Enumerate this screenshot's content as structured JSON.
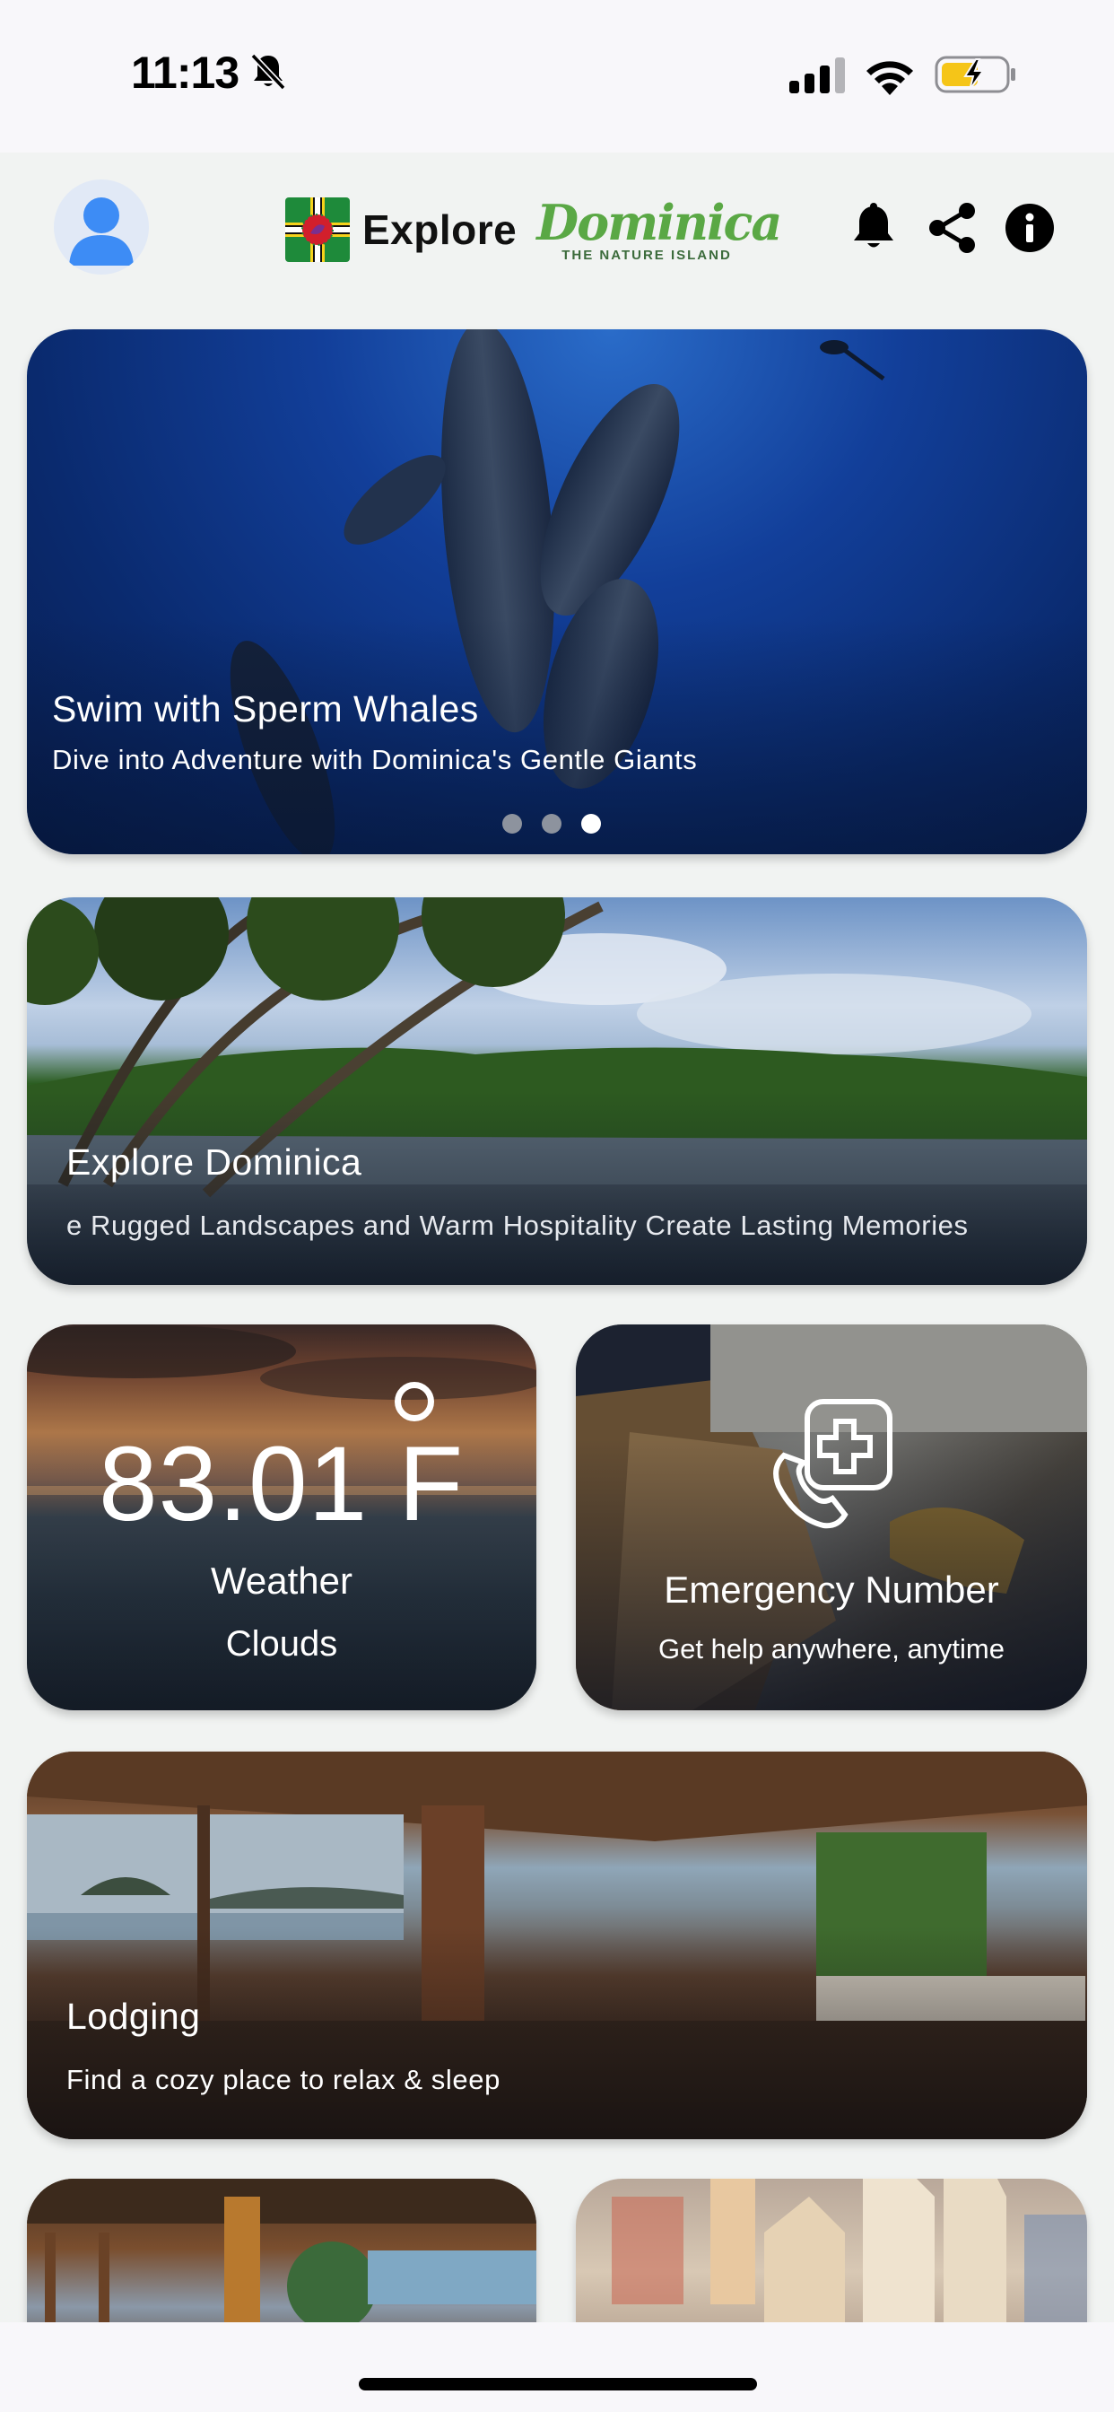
{
  "status_bar": {
    "time": "11:13",
    "icons": [
      "bell-muted-icon",
      "cellular-signal-icon",
      "wifi-icon",
      "battery-charging-icon"
    ],
    "battery_color": "#f5c518"
  },
  "header": {
    "avatar_icon": "user-avatar-icon",
    "logo_word": "Explore",
    "brand_name": "Dominica",
    "brand_tagline": "THE NATURE ISLAND",
    "brand_color": "#5aa845",
    "actions": [
      "bell-icon",
      "share-icon",
      "info-icon"
    ]
  },
  "hero": {
    "title": "Swim with Sperm Whales",
    "subtitle": "Dive into Adventure with Dominica's Gentle Giants",
    "slides": 3,
    "active_slide": 3
  },
  "explore": {
    "title": "Explore Dominica",
    "subtitle": "e Rugged Landscapes and Warm Hospitality Create Lasting Memories"
  },
  "weather": {
    "temperature": "83.01 F",
    "label": "Weather",
    "condition": "Clouds"
  },
  "emergency": {
    "title": "Emergency Number",
    "subtitle": "Get help anywhere, anytime",
    "icon": "emergency-phone-medical-icon"
  },
  "lodging": {
    "title": "Lodging",
    "subtitle": "Find a cozy place to relax & sleep"
  },
  "tiles": [
    "restaurant-tile",
    "market-tile"
  ]
}
